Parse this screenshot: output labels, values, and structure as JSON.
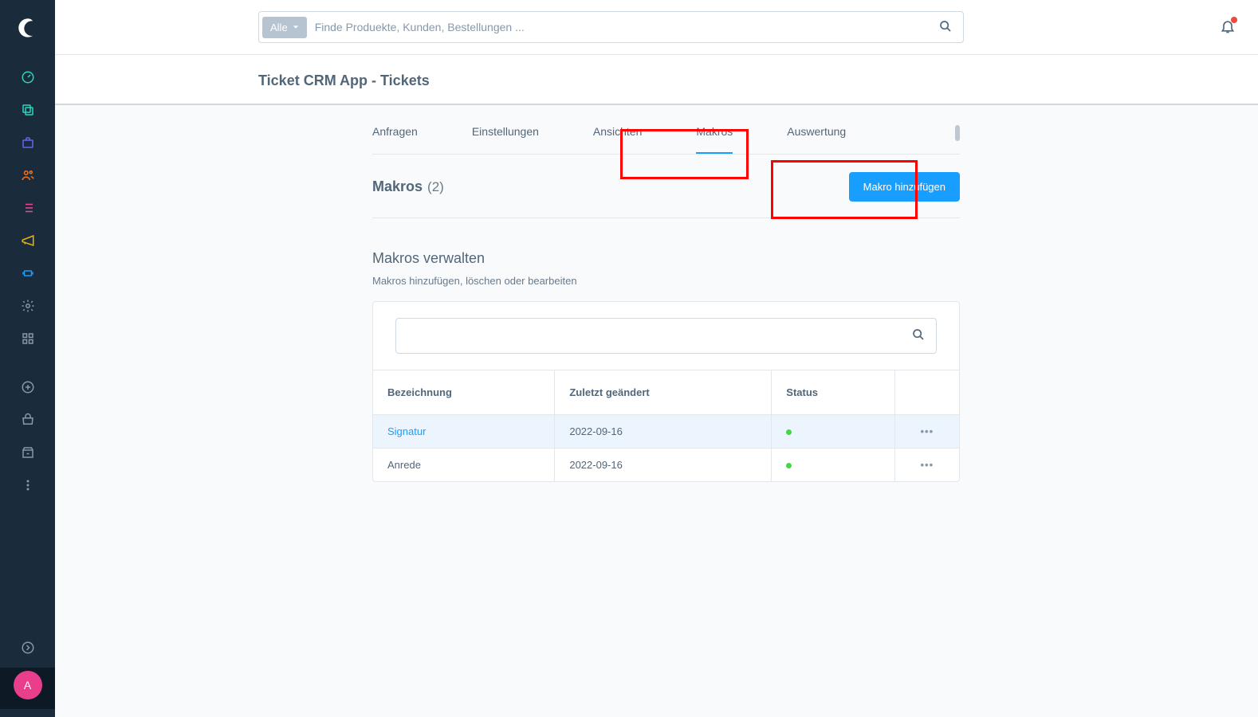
{
  "search": {
    "filter_label": "Alle",
    "placeholder": "Finde Produekte, Kunden, Bestellungen ..."
  },
  "page_title": "Ticket CRM App - Tickets",
  "tabs": [
    {
      "label": "Anfragen",
      "active": false
    },
    {
      "label": "Einstellungen",
      "active": false
    },
    {
      "label": "Ansichten",
      "active": false
    },
    {
      "label": "Makros",
      "active": true
    },
    {
      "label": "Auswertung",
      "active": false
    }
  ],
  "section": {
    "label": "Makros",
    "count": "(2)",
    "add_btn": "Makro hinzufügen"
  },
  "subsection": {
    "title": "Makros verwalten",
    "desc": "Makros hinzufügen, löschen oder bearbeiten"
  },
  "table": {
    "headers": {
      "name": "Bezeichnung",
      "changed": "Zuletzt geändert",
      "status": "Status"
    },
    "rows": [
      {
        "name": "Signatur",
        "changed": "2022-09-16",
        "status": "active",
        "hovered": true
      },
      {
        "name": "Anrede",
        "changed": "2022-09-16",
        "status": "active",
        "hovered": false
      }
    ]
  },
  "avatar_initial": "A",
  "colors": {
    "accent": "#189eff",
    "sidebar": "#1a2b3c"
  }
}
